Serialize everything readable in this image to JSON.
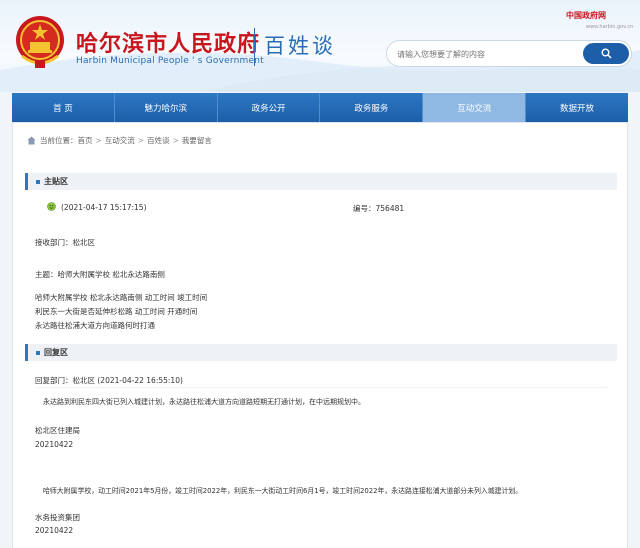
{
  "header": {
    "site_title": "哈尔滨市人民政府",
    "site_subtitle": "Harbin Municipal People ' s Government",
    "section_title": "百姓谈",
    "china_gov": "中国政府网",
    "china_gov_url": "www.harbin.gov.cn",
    "search_placeholder": "请输入您想要了解的内容"
  },
  "nav": {
    "items": [
      {
        "label": "首 页"
      },
      {
        "label": "魅力哈尔滨"
      },
      {
        "label": "政务公开"
      },
      {
        "label": "政务服务"
      },
      {
        "label": "互动交流"
      },
      {
        "label": "数据开放"
      }
    ]
  },
  "breadcrumb": {
    "prefix": "当前位置：",
    "items": [
      "首页",
      "互动交流",
      "百姓谈",
      "我要留言"
    ],
    "sep": ">"
  },
  "main_post": {
    "section_label": "主贴区",
    "datetime": "(2021-04-17 15:17:15)",
    "number": "编号：756481",
    "department": "接收部门：松北区",
    "subject": "主题：哈师大附属学校 松北永达路南侧",
    "body_lines": [
      "哈师大附属学校 松北永达路南侧 动工时间 竣工时间",
      "利民东一大街是否延伸杉松路 动工时间 开通时间",
      "永达路往松浦大道方向道路何时打通"
    ]
  },
  "reply": {
    "section_label": "回复区",
    "header": "回复部门：松北区 (2021-04-22 16:55:10)",
    "text1": "永达路到利民东四大街已列入城建计划，永达路往松浦大道方向道路短期无打通计划，在中远期规划中。",
    "org1": "松北区住建局",
    "date1": "20210422",
    "text2": "哈师大附属学校，动工时间2021年5月份，竣工时间2022年，利民东一大街动工时间6月1号，竣工时间2022年，永达路连接松浦大道部分未列入城建计划。",
    "org2": "水务投资集团",
    "date2": "20210422"
  },
  "colors": {
    "nav_bg": "#1d5ea8",
    "nav_active": "#8fb9e3",
    "title_red": "#c8161d",
    "accent_blue": "#2a6db5"
  }
}
